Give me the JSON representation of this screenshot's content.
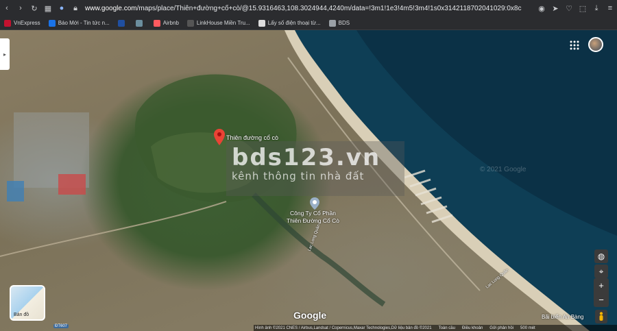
{
  "browser": {
    "url_prefix": "www.google.com",
    "url_rest": "/maps/place/Thiên+đường+cổ+cò/@15.9316463,108.3024944,4240m/data=!3m1!1e3!4m5!3m4!1s0x3142118702041029:0x8c"
  },
  "bookmarks": [
    {
      "label": "VnExpress",
      "color": "#c4122f",
      "icon": "vnexpress-icon"
    },
    {
      "label": "Báo Mới - Tin tức n...",
      "color": "#1a73e8",
      "icon": "baomoi-icon"
    },
    {
      "label": "",
      "color": "#1f4fa1",
      "icon": "bookmark-icon"
    },
    {
      "label": "",
      "color": "#6b8e9e",
      "icon": "bookmark-icon"
    },
    {
      "label": "Airbnb",
      "color": "#ff5a5f",
      "icon": "airbnb-icon"
    },
    {
      "label": "LinkHouse Miền Tru...",
      "color": "#555555",
      "icon": "linkhouse-icon"
    },
    {
      "label": "Lấy số điện thoại từ...",
      "color": "#dddddd",
      "icon": "document-icon"
    },
    {
      "label": "BDS",
      "color": "#9aa0a6",
      "icon": "folder-icon"
    }
  ],
  "map": {
    "place_label": "Thiên đường cổ cò",
    "poi_line1": "Công Ty Cổ Phần",
    "poi_line2": "Thiên Đường Cổ Cò",
    "watermark_big": "bds123.vn",
    "watermark_small": "kênh thông tin nhà đất",
    "faint_copyright": "© 2021 Google",
    "google_logo": "Google",
    "layer_label": "Bản đồ",
    "beach_label": "Bãi biển An Bàng",
    "road_label_1": "Lạc Long Quân",
    "road_label_2": "Lạc Long Quân",
    "road_dt": "ĐT607",
    "footer": [
      "Hình ảnh ©2021 CNES / Airbus,Landsat / Copernicus,Maxar Technologies,Dữ liệu bản đồ ©2021",
      "Toàn cầu",
      "Điều khoản",
      "Gửi phản hồi",
      "500 mét"
    ]
  }
}
